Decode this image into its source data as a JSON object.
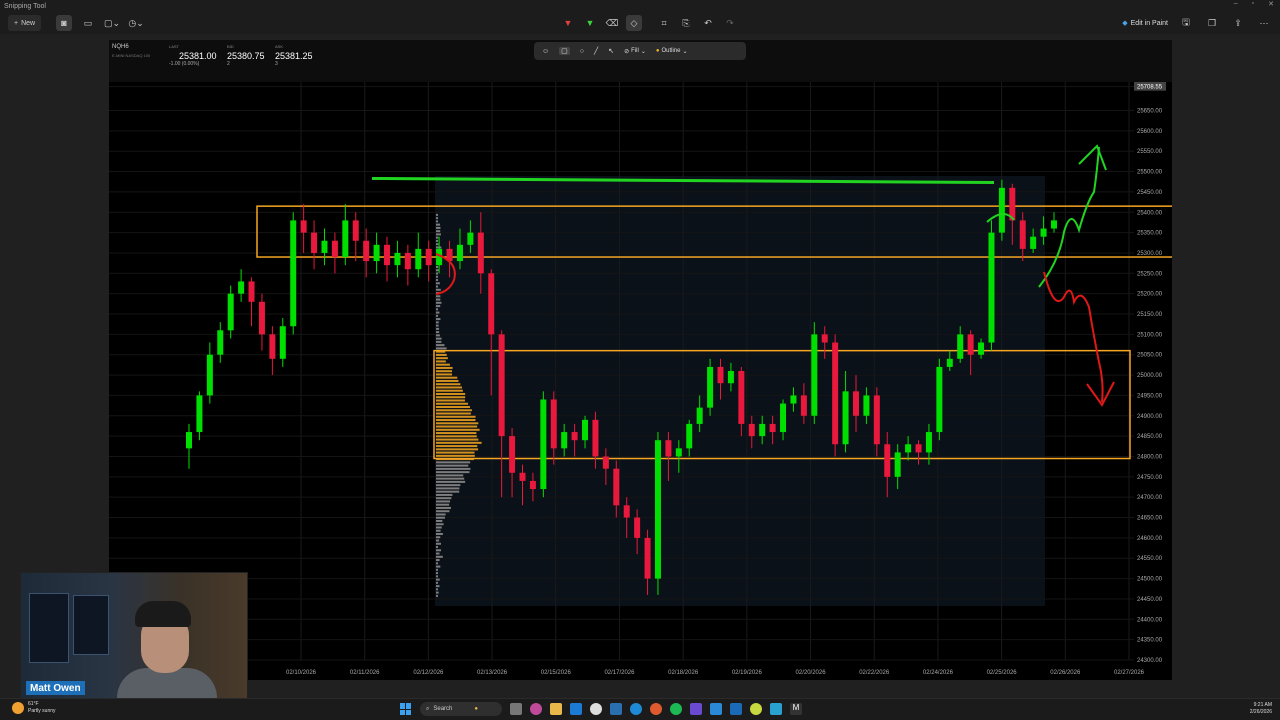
{
  "app": {
    "title": "Snipping Tool",
    "new_label": "New",
    "edit_in_paint_label": "Edit in Paint"
  },
  "shape_toolbar": {
    "fill_label": "Fill",
    "outline_label": "Outline"
  },
  "quote": {
    "symbol": "NQH6",
    "symbol_sub": "E-MINI NASDAQ 100",
    "last_label": "LAST",
    "last_value": "25381.00",
    "last_change": "-1.00 (0.00%)",
    "bid_label": "BID",
    "bid_value": "25380.75",
    "bid_size": "2",
    "ask_label": "ASK",
    "ask_value": "25381.25",
    "ask_size": "3"
  },
  "presenter": {
    "name": "Matt Owen"
  },
  "taskbar": {
    "weather_temp": "61°F",
    "weather_desc": "Partly sunny",
    "search_label": "Search",
    "time": "9:21 AM",
    "date": "2/26/2026"
  },
  "colors": {
    "up": "#00e000",
    "down": "#e8193c",
    "zone": "#f5a623",
    "marker_green": "#22d422",
    "marker_red": "#e01818"
  },
  "chart_data": {
    "type": "candlestick",
    "price_axis": [
      "25708.55",
      "25650.00",
      "25600.00",
      "25550.00",
      "25500.00",
      "25450.00",
      "25400.00",
      "25350.00",
      "25300.00",
      "25250.00",
      "25200.00",
      "25150.00",
      "25100.00",
      "25050.00",
      "25000.00",
      "24950.00",
      "24900.00",
      "24850.00",
      "24800.00",
      "24750.00",
      "24700.00",
      "24650.00",
      "24600.00",
      "24550.00",
      "24500.00",
      "24450.00",
      "24400.00",
      "24350.00",
      "24300.00"
    ],
    "date_axis": [
      "02/10/2026",
      "02/11/2026",
      "02/12/2026",
      "02/13/2026",
      "02/15/2026",
      "02/17/2026",
      "02/18/2026",
      "02/19/2026",
      "02/20/2026",
      "02/22/2026",
      "02/24/2026",
      "02/25/2026",
      "02/26/2026",
      "02/27/2026"
    ],
    "ylim": [
      24300,
      25720
    ],
    "upper_zone": [
      25290,
      25415
    ],
    "lower_zone": [
      24795,
      25060
    ],
    "resistance_line": 25475,
    "candles": [
      [
        24820,
        24860,
        24770,
        24880
      ],
      [
        24860,
        24950,
        24840,
        24960
      ],
      [
        24950,
        25050,
        24930,
        25080
      ],
      [
        25050,
        25110,
        25030,
        25130
      ],
      [
        25110,
        25200,
        25090,
        25220
      ],
      [
        25200,
        25230,
        25180,
        25260
      ],
      [
        25230,
        25180,
        25120,
        25240
      ],
      [
        25180,
        25100,
        25060,
        25200
      ],
      [
        25100,
        25040,
        25000,
        25120
      ],
      [
        25040,
        25120,
        25020,
        25140
      ],
      [
        25120,
        25380,
        25100,
        25400
      ],
      [
        25380,
        25350,
        25300,
        25420
      ],
      [
        25350,
        25300,
        25260,
        25380
      ],
      [
        25300,
        25330,
        25270,
        25360
      ],
      [
        25330,
        25290,
        25250,
        25350
      ],
      [
        25290,
        25380,
        25270,
        25420
      ],
      [
        25380,
        25330,
        25280,
        25400
      ],
      [
        25330,
        25280,
        25240,
        25360
      ],
      [
        25280,
        25320,
        25250,
        25350
      ],
      [
        25320,
        25270,
        25230,
        25340
      ],
      [
        25270,
        25300,
        25240,
        25330
      ],
      [
        25300,
        25260,
        25220,
        25320
      ],
      [
        25260,
        25310,
        25240,
        25350
      ],
      [
        25310,
        25270,
        25230,
        25330
      ],
      [
        25270,
        25310,
        25250,
        25340
      ],
      [
        25310,
        25280,
        25240,
        25330
      ],
      [
        25280,
        25320,
        25260,
        25360
      ],
      [
        25320,
        25350,
        25300,
        25380
      ],
      [
        25350,
        25250,
        25200,
        25400
      ],
      [
        25250,
        25100,
        24950,
        25260
      ],
      [
        25100,
        24850,
        24700,
        25110
      ],
      [
        24850,
        24760,
        24700,
        24870
      ],
      [
        24760,
        24740,
        24680,
        24780
      ],
      [
        24740,
        24720,
        24690,
        24760
      ],
      [
        24720,
        24940,
        24700,
        24960
      ],
      [
        24940,
        24820,
        24780,
        24960
      ],
      [
        24820,
        24860,
        24800,
        24880
      ],
      [
        24860,
        24840,
        24800,
        24880
      ],
      [
        24840,
        24890,
        24820,
        24900
      ],
      [
        24890,
        24800,
        24770,
        24910
      ],
      [
        24800,
        24770,
        24730,
        24820
      ],
      [
        24770,
        24680,
        24650,
        24790
      ],
      [
        24680,
        24650,
        24600,
        24700
      ],
      [
        24650,
        24600,
        24560,
        24670
      ],
      [
        24600,
        24500,
        24460,
        24620
      ],
      [
        24500,
        24840,
        24460,
        24860
      ],
      [
        24840,
        24800,
        24740,
        24860
      ],
      [
        24800,
        24820,
        24760,
        24840
      ],
      [
        24820,
        24880,
        24800,
        24890
      ],
      [
        24880,
        24920,
        24860,
        24950
      ],
      [
        24920,
        25020,
        24900,
        25040
      ],
      [
        25020,
        24980,
        24940,
        25040
      ],
      [
        24980,
        25010,
        24960,
        25030
      ],
      [
        25010,
        24880,
        24850,
        25020
      ],
      [
        24880,
        24850,
        24820,
        24900
      ],
      [
        24850,
        24880,
        24830,
        24900
      ],
      [
        24880,
        24860,
        24830,
        24900
      ],
      [
        24860,
        24930,
        24840,
        24940
      ],
      [
        24930,
        24950,
        24910,
        24970
      ],
      [
        24950,
        24900,
        24880,
        24980
      ],
      [
        24900,
        25100,
        24880,
        25130
      ],
      [
        25100,
        25080,
        25040,
        25120
      ],
      [
        25080,
        24830,
        24800,
        25100
      ],
      [
        24830,
        24960,
        24810,
        25010
      ],
      [
        24960,
        24900,
        24860,
        25000
      ],
      [
        24900,
        24950,
        24880,
        24970
      ],
      [
        24950,
        24830,
        24800,
        24970
      ],
      [
        24830,
        24750,
        24700,
        24860
      ],
      [
        24750,
        24810,
        24720,
        24830
      ],
      [
        24810,
        24830,
        24790,
        24850
      ],
      [
        24830,
        24810,
        24780,
        24840
      ],
      [
        24810,
        24860,
        24780,
        24880
      ],
      [
        24860,
        25020,
        24840,
        25040
      ],
      [
        25020,
        25040,
        25010,
        25060
      ],
      [
        25040,
        25100,
        25030,
        25120
      ],
      [
        25100,
        25050,
        25000,
        25110
      ],
      [
        25050,
        25080,
        25040,
        25090
      ],
      [
        25080,
        25350,
        25060,
        25380
      ],
      [
        25350,
        25460,
        25330,
        25480
      ],
      [
        25460,
        25380,
        25320,
        25470
      ],
      [
        25380,
        25310,
        25280,
        25400
      ],
      [
        25310,
        25340,
        25300,
        25360
      ],
      [
        25340,
        25360,
        25320,
        25390
      ],
      [
        25360,
        25380,
        25350,
        25400
      ]
    ]
  }
}
